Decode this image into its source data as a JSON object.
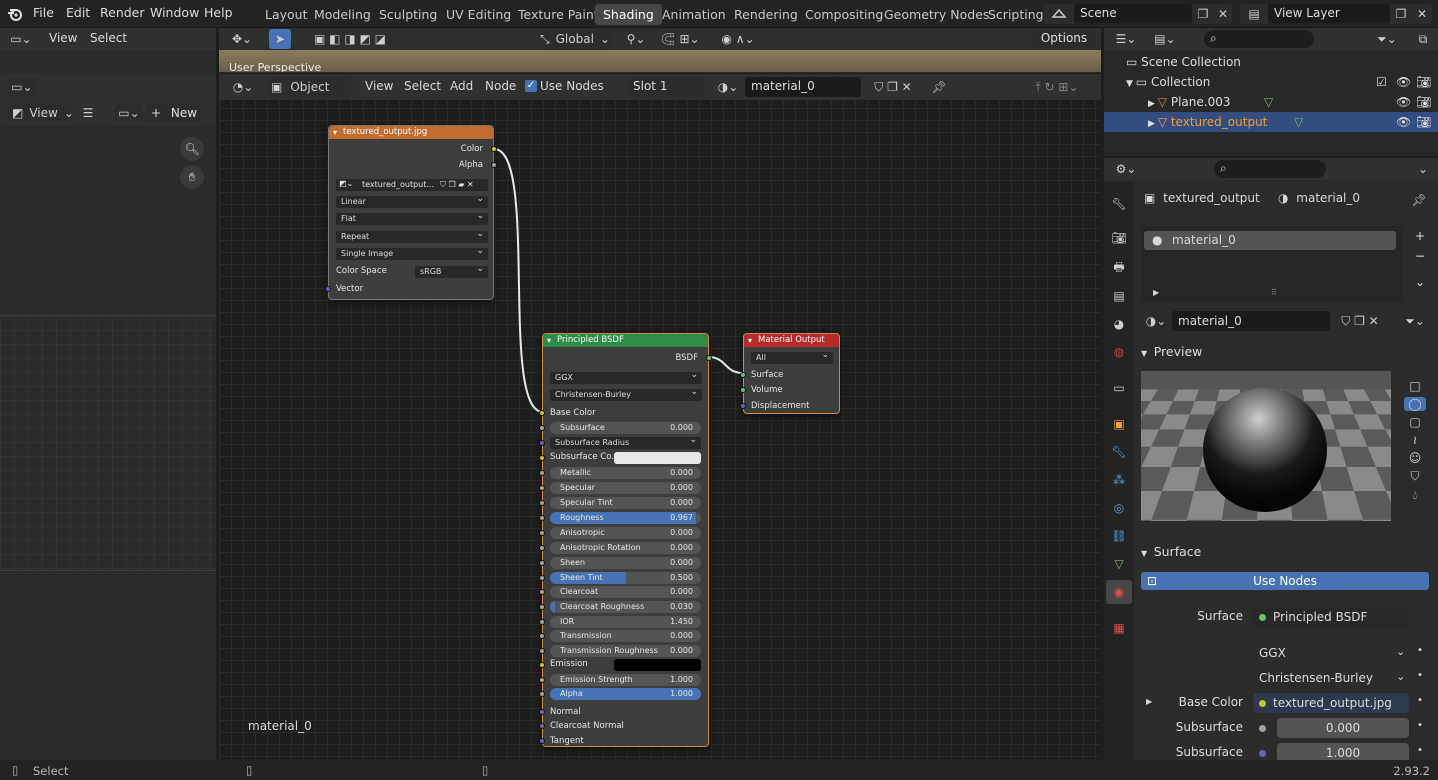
{
  "menu": {
    "file": "File",
    "edit": "Edit",
    "render": "Render",
    "window": "Window",
    "help": "Help"
  },
  "workspaces": [
    "Layout",
    "Modeling",
    "Sculpting",
    "UV Editing",
    "Texture Paint",
    "Shading",
    "Animation",
    "Rendering",
    "Compositing",
    "Geometry Nodes",
    "Scripting"
  ],
  "active_workspace": "Shading",
  "scene": {
    "name": "Scene",
    "view_layer": "View Layer"
  },
  "left_header": {
    "view": "View",
    "select": "Select"
  },
  "left_image_header": {
    "view": "View",
    "new": "New"
  },
  "viewport": {
    "transform": "Global",
    "options": "Options",
    "label": "User Perspective"
  },
  "node_header": {
    "mode": "Object",
    "view": "View",
    "select": "Select",
    "add": "Add",
    "node": "Node",
    "use_nodes": "Use Nodes",
    "slot": "Slot 1",
    "material": "material_0"
  },
  "node_editor": {
    "material_label": "material_0"
  },
  "image_node": {
    "title": "textured_output.jpg",
    "out_color": "Color",
    "out_alpha": "Alpha",
    "image_name": "textured_output...",
    "interpolation": "Linear",
    "projection": "Flat",
    "extension": "Repeat",
    "source": "Single Image",
    "colorspace_label": "Color Space",
    "colorspace": "sRGB",
    "in_vector": "Vector"
  },
  "bsdf_node": {
    "title": "Principled BSDF",
    "out": "BSDF",
    "distribution": "GGX",
    "subsurface_method": "Christensen-Burley",
    "base_color": "Base Color",
    "subsurface_radius": "Subsurface Radius",
    "subsurface_color": "Subsurface Co...",
    "emission": "Emission",
    "normal": "Normal",
    "clearcoat_normal": "Clearcoat Normal",
    "tangent": "Tangent",
    "sliders": [
      {
        "label": "Subsurface",
        "value": "0.000",
        "fill": 0
      },
      {
        "label": "Metallic",
        "value": "0.000",
        "fill": 0
      },
      {
        "label": "Specular",
        "value": "0.000",
        "fill": 0
      },
      {
        "label": "Specular Tint",
        "value": "0.000",
        "fill": 0
      },
      {
        "label": "Roughness",
        "value": "0.967",
        "fill": 0.967
      },
      {
        "label": "Anisotropic",
        "value": "0.000",
        "fill": 0
      },
      {
        "label": "Anisotropic Rotation",
        "value": "0.000",
        "fill": 0
      },
      {
        "label": "Sheen",
        "value": "0.000",
        "fill": 0
      },
      {
        "label": "Sheen Tint",
        "value": "0.500",
        "fill": 0.5
      },
      {
        "label": "Clearcoat",
        "value": "0.000",
        "fill": 0
      },
      {
        "label": "Clearcoat Roughness",
        "value": "0.030",
        "fill": 0.03
      },
      {
        "label": "IOR",
        "value": "1.450",
        "fill": 0
      },
      {
        "label": "Transmission",
        "value": "0.000",
        "fill": 0
      },
      {
        "label": "Transmission Roughness",
        "value": "0.000",
        "fill": 0
      },
      {
        "label": "Emission Strength",
        "value": "1.000",
        "fill": 0
      },
      {
        "label": "Alpha",
        "value": "1.000",
        "fill": 1
      }
    ]
  },
  "output_node": {
    "title": "Material Output",
    "target": "All",
    "surface": "Surface",
    "volume": "Volume",
    "displacement": "Displacement"
  },
  "outliner": {
    "scene_collection": "Scene Collection",
    "collection": "Collection",
    "obj1": "Plane.003",
    "obj2": "textured_output"
  },
  "properties": {
    "object": "textured_output",
    "material": "material_0",
    "slot_item": "material_0",
    "material_field": "material_0",
    "preview": "Preview",
    "surface_section": "Surface",
    "use_nodes": "Use Nodes",
    "rows": [
      {
        "label": "Surface",
        "value": "Principled BSDF",
        "dot": "#63c763"
      },
      {
        "label": "",
        "value": "GGX",
        "dot": ""
      },
      {
        "label": "",
        "value": "Christensen-Burley",
        "dot": ""
      },
      {
        "label": "Base Color",
        "value": "textured_output.jpg",
        "dot": "#c7c729"
      },
      {
        "label": "Subsurface",
        "value": "0.000",
        "dot": "#a1a1a1"
      },
      {
        "label": "Subsurface Radius",
        "value": "1.000",
        "dot": "#6363c7"
      }
    ]
  },
  "status": {
    "select": "Select",
    "version": "2.93.2"
  },
  "colors": {
    "accent": "#4772b3",
    "image_node": "#c36c30",
    "shader_node": "#2f8c48",
    "output_node": "#b52a2a"
  }
}
